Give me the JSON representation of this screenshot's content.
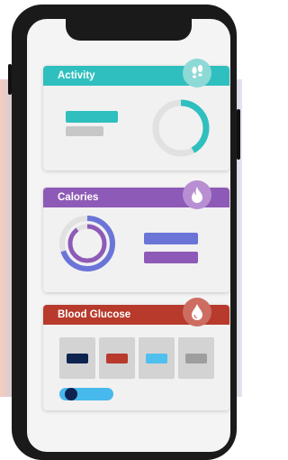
{
  "colors": {
    "activity": "#2fbfbe",
    "calories": "#8e5ab7",
    "glucose": "#b83a2c",
    "calorie_bar": "#6b75d8",
    "ring_grey": "#e1e1e1",
    "glucose_swatches": [
      "#0d2350",
      "#b73a2d",
      "#4fbfed",
      "#9e9e9e"
    ],
    "slider_track": "#47b9ec",
    "slider_knob": "#0e2350"
  },
  "cards": {
    "activity": {
      "title": "Activity",
      "icon": "footprints-icon",
      "ring_progress": 0.42
    },
    "calories": {
      "title": "Calories",
      "icon": "flame-icon",
      "ring_progress": 0.7
    },
    "glucose": {
      "title": "Blood Glucose",
      "icon": "drop-icon",
      "slider_value": 0.12
    }
  }
}
